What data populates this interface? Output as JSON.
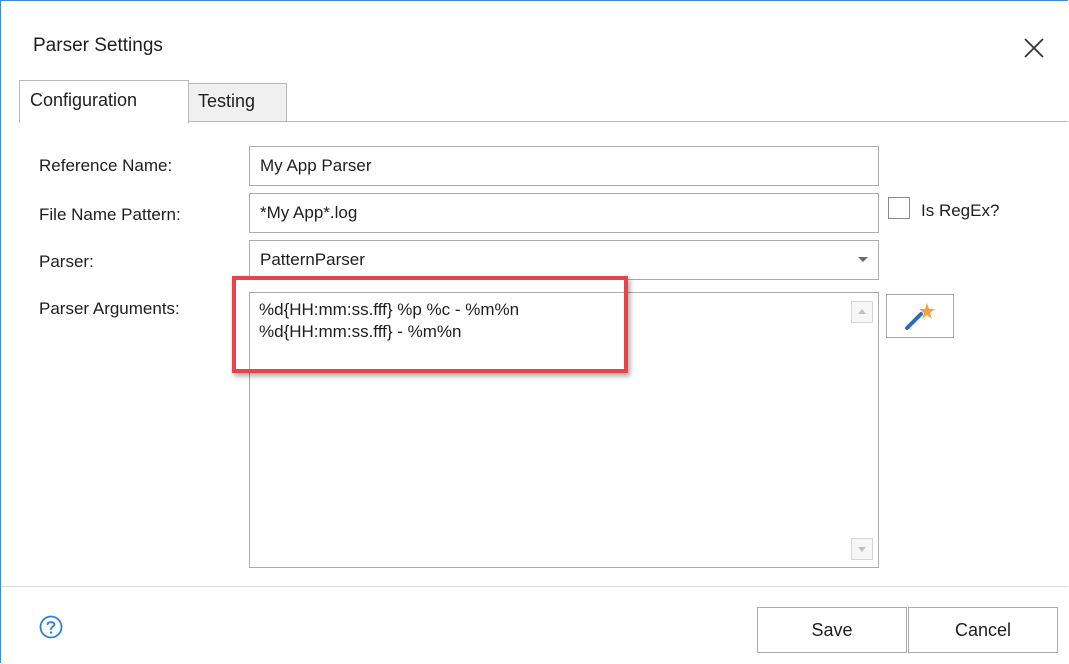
{
  "window": {
    "title": "Parser Settings"
  },
  "tabs": [
    {
      "label": "Configuration",
      "active": true
    },
    {
      "label": "Testing",
      "active": false
    }
  ],
  "form": {
    "reference_name": {
      "label": "Reference Name:",
      "value": "My App Parser"
    },
    "file_name_pattern": {
      "label": "File Name Pattern:",
      "value": "*My App*.log"
    },
    "is_regex": {
      "label": "Is RegEx?",
      "checked": false
    },
    "parser": {
      "label": "Parser:",
      "value": "PatternParser"
    },
    "parser_arguments": {
      "label": "Parser Arguments:",
      "lines": [
        "%d{HH:mm:ss.fff} %p %c - %m%n",
        "%d{HH:mm:ss.fff} - %m%n"
      ]
    }
  },
  "footer": {
    "save_label": "Save",
    "cancel_label": "Cancel"
  },
  "icons": {
    "close": "close-icon",
    "help": "help-icon",
    "wand": "magic-wand-icon"
  },
  "colors": {
    "highlight": "#e8434a",
    "window_border": "#3c8ad6",
    "help_icon": "#2f7fd6"
  }
}
